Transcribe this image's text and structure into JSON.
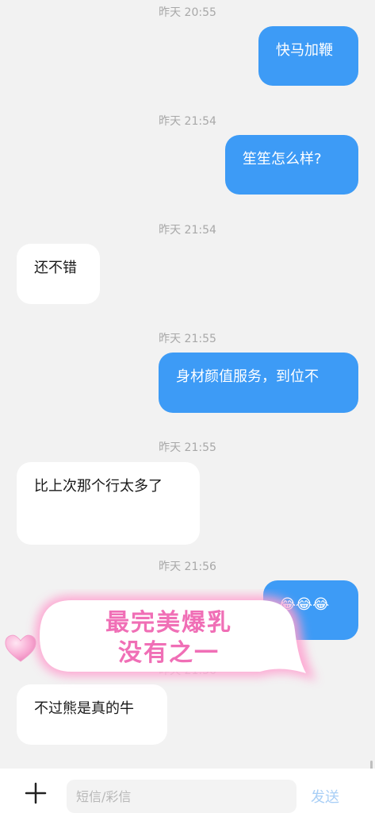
{
  "messages": [
    {
      "time": "昨天 20:55",
      "direction": "out",
      "text": "快马加鞭"
    },
    {
      "time": "昨天 21:54",
      "direction": "out",
      "text": "笙笙怎么样?"
    },
    {
      "time": "昨天 21:54",
      "direction": "in",
      "text": "还不错"
    },
    {
      "time": "昨天 21:55",
      "direction": "out",
      "text": "身材颜值服务，到位不"
    },
    {
      "time": "昨天 21:55",
      "direction": "in",
      "text": "比上次那个行太多了"
    },
    {
      "time": "昨天 21:56",
      "direction": "out",
      "text": "😂😂😂"
    },
    {
      "time": "昨天 21:56",
      "direction": "in",
      "text": "不过熊是真的牛"
    }
  ],
  "sticker": {
    "line1": "最完美爆乳",
    "line2": "没有之一"
  },
  "composer": {
    "placeholder": "短信/彩信",
    "send_label": "发送"
  },
  "icons": {
    "add": "plus-icon",
    "heart": "heart-icon"
  },
  "colors": {
    "outgoing_bubble": "#3d9bf6",
    "incoming_bubble": "#ffffff",
    "sticker_text": "#f06fb6"
  }
}
